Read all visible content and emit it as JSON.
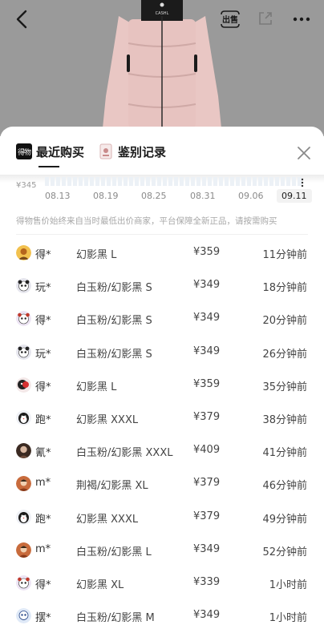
{
  "header": {
    "sell_label": "出售",
    "brand_mark": "CASHL"
  },
  "colors": {
    "jacket_pink": "#e9c7c4",
    "jacket_black": "#1b1b1b",
    "dim_overlay": "#9a9a9a",
    "underline": "#1a1a1a"
  },
  "tabs": [
    {
      "label": "最近购买",
      "logo_text": "得物",
      "active": true
    },
    {
      "label": "鉴别记录",
      "active": false
    }
  ],
  "chart": {
    "price_tick": "¥345",
    "dates": [
      "08.13",
      "08.19",
      "08.25",
      "08.31",
      "09.06",
      "09.11"
    ],
    "selected_date": "09.11"
  },
  "disclaimer": "得物售价始终来自当时最低出价商家，平台保障全新正品，请按需购买",
  "records": [
    {
      "user": "得*",
      "variant": "幻影黑 L",
      "price": "¥359",
      "time": "11分钟前",
      "avatar": "avatar-orange"
    },
    {
      "user": "玩*",
      "variant": "白玉粉/幻影黑 S",
      "price": "¥349",
      "time": "18分钟前",
      "avatar": "avatar-panda"
    },
    {
      "user": "得*",
      "variant": "白玉粉/幻影黑 S",
      "price": "¥349",
      "time": "20分钟前",
      "avatar": "avatar-cartoon"
    },
    {
      "user": "玩*",
      "variant": "白玉粉/幻影黑 S",
      "price": "¥349",
      "time": "26分钟前",
      "avatar": "avatar-panda"
    },
    {
      "user": "得*",
      "variant": "幻影黑 L",
      "price": "¥359",
      "time": "35分钟前",
      "avatar": "avatar-red"
    },
    {
      "user": "跑*",
      "variant": "幻影黑 XXXL",
      "price": "¥379",
      "time": "38分钟前",
      "avatar": "avatar-penguin"
    },
    {
      "user": "氰*",
      "variant": "白玉粉/幻影黑 XXXL",
      "price": "¥409",
      "time": "41分钟前",
      "avatar": "avatar-photo"
    },
    {
      "user": "m*",
      "variant": "荆褐/幻影黑 XL",
      "price": "¥379",
      "time": "46分钟前",
      "avatar": "avatar-person"
    },
    {
      "user": "跑*",
      "variant": "幻影黑 XXXL",
      "price": "¥379",
      "time": "49分钟前",
      "avatar": "avatar-penguin"
    },
    {
      "user": "m*",
      "variant": "白玉粉/幻影黑 L",
      "price": "¥349",
      "time": "52分钟前",
      "avatar": "avatar-person"
    },
    {
      "user": "得*",
      "variant": "幻影黑 XL",
      "price": "¥339",
      "time": "1小时前",
      "avatar": "avatar-cartoon"
    },
    {
      "user": "摆*",
      "variant": "白玉粉/幻影黑 M",
      "price": "¥349",
      "time": "1小时前",
      "avatar": "avatar-blue"
    }
  ]
}
